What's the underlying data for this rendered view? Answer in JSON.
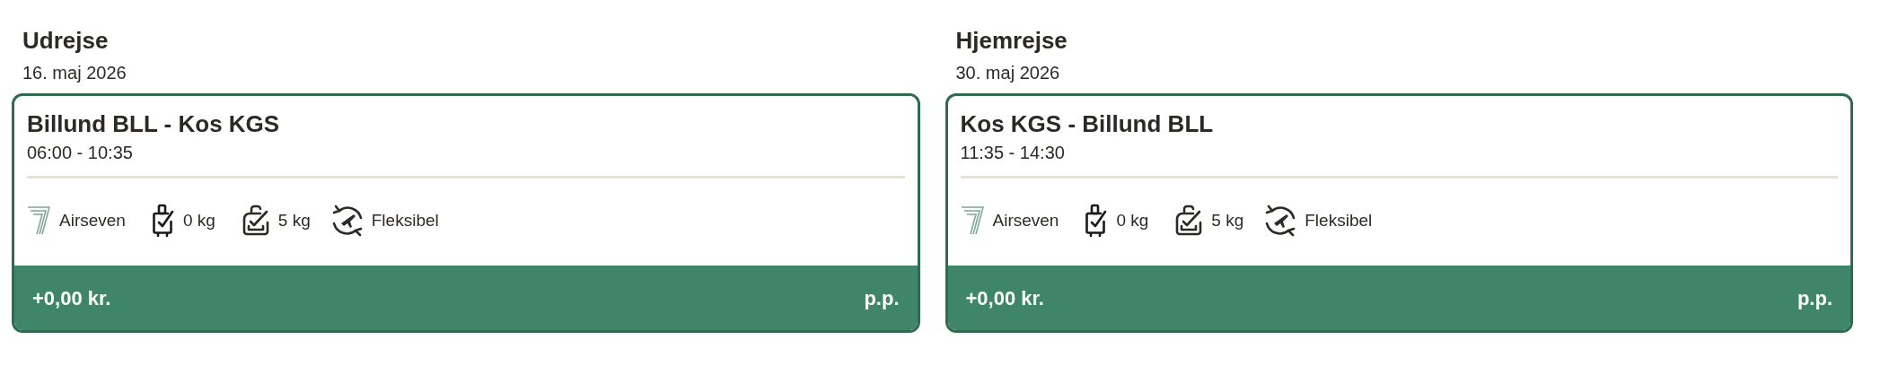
{
  "legs": [
    {
      "title": "Udrejse",
      "date": "16. maj 2026",
      "route": "Billund BLL - Kos KGS",
      "time": "06:00 - 10:35",
      "airline": "Airseven",
      "carry_on": "0 kg",
      "checked_bag": "5 kg",
      "fare": "Fleksibel",
      "price": "+0,00 kr.",
      "unit": "p.p."
    },
    {
      "title": "Hjemrejse",
      "date": "30. maj 2026",
      "route": "Kos KGS - Billund BLL",
      "time": "11:35 - 14:30",
      "airline": "Airseven",
      "carry_on": "0 kg",
      "checked_bag": "5 kg",
      "fare": "Fleksibel",
      "price": "+0,00 kr.",
      "unit": "p.p."
    }
  ]
}
